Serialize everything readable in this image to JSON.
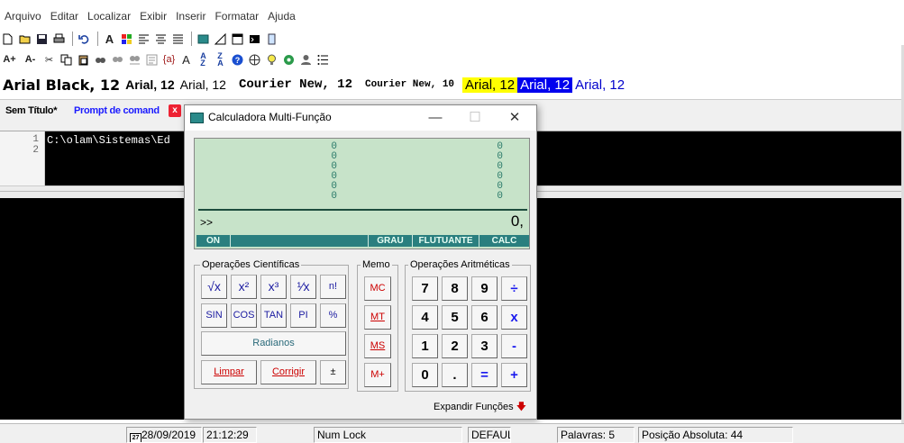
{
  "menu": [
    "Arquivo",
    "Editar",
    "Localizar",
    "Exibir",
    "Inserir",
    "Formatar",
    "Ajuda"
  ],
  "fonts": {
    "f1": "Arial Black, 12",
    "f2": "Arial, 12",
    "f3": "Arial, 12",
    "f4": "Courier New, 12",
    "f5": "Courier New, 10",
    "f6": "Arial, 12",
    "f7": "Arial, 12",
    "f8": "Arial, 12"
  },
  "tabs": {
    "tab1": "Sem Título*",
    "tab2": "Prompt de comand",
    "close": "x"
  },
  "editor": {
    "lines": [
      "1",
      "2"
    ],
    "code": "C:\\olam\\Sistemas\\Ed"
  },
  "calculator": {
    "title": "Calculadora Multi-Função",
    "controls": {
      "minimize": "—",
      "maximize": "☐",
      "close": "✕"
    },
    "display": {
      "left_stack": [
        "0",
        "0",
        "0",
        "0",
        "0",
        "0"
      ],
      "right_stack": [
        "0",
        "0",
        "0",
        "0",
        "0",
        "0"
      ],
      "prompt": ">>",
      "value": "0,"
    },
    "status": {
      "on": "ON",
      "grau": "GRAU",
      "flutuante": "FLUTUANTE",
      "calc": "CALC"
    },
    "groups": {
      "scientific": "Operações Científicas",
      "memo": "Memo",
      "arithmetic": "Operações Aritméticas"
    },
    "sci": {
      "sqrt": "√x",
      "x2": "x²",
      "x3": "x³",
      "inv": "¹⁄x",
      "fact": "n!",
      "sin": "SIN",
      "cos": "COS",
      "tan": "TAN",
      "pi": "PI",
      "pct": "%",
      "radianos": "Radianos",
      "limpar": "Limpar",
      "corrigir": "Corrigir",
      "pm": "±"
    },
    "memo": {
      "mc": "MC",
      "mt": "MT",
      "ms": "MS",
      "mplus": "M+"
    },
    "arith": {
      "n7": "7",
      "n8": "8",
      "n9": "9",
      "div": "÷",
      "n4": "4",
      "n5": "5",
      "n6": "6",
      "mul": "x",
      "n1": "1",
      "n2": "2",
      "n3": "3",
      "sub": "-",
      "n0": "0",
      "dot": ".",
      "eq": "=",
      "add": "+"
    },
    "expand": "Expandir Funções",
    "expand_arrow": "🡇"
  },
  "status": {
    "date": "28/09/2019",
    "time": "21:12:29",
    "numlock": "Num Lock",
    "default": "DEFAUL",
    "words": "Palavras: 5",
    "position": "Posição Absoluta: 44"
  },
  "colors": {
    "display_bg": "#c7e3c9",
    "status_bar": "#2a7f7f",
    "highlight_yellow": "#ffff00",
    "highlight_blue": "#0000ee"
  }
}
